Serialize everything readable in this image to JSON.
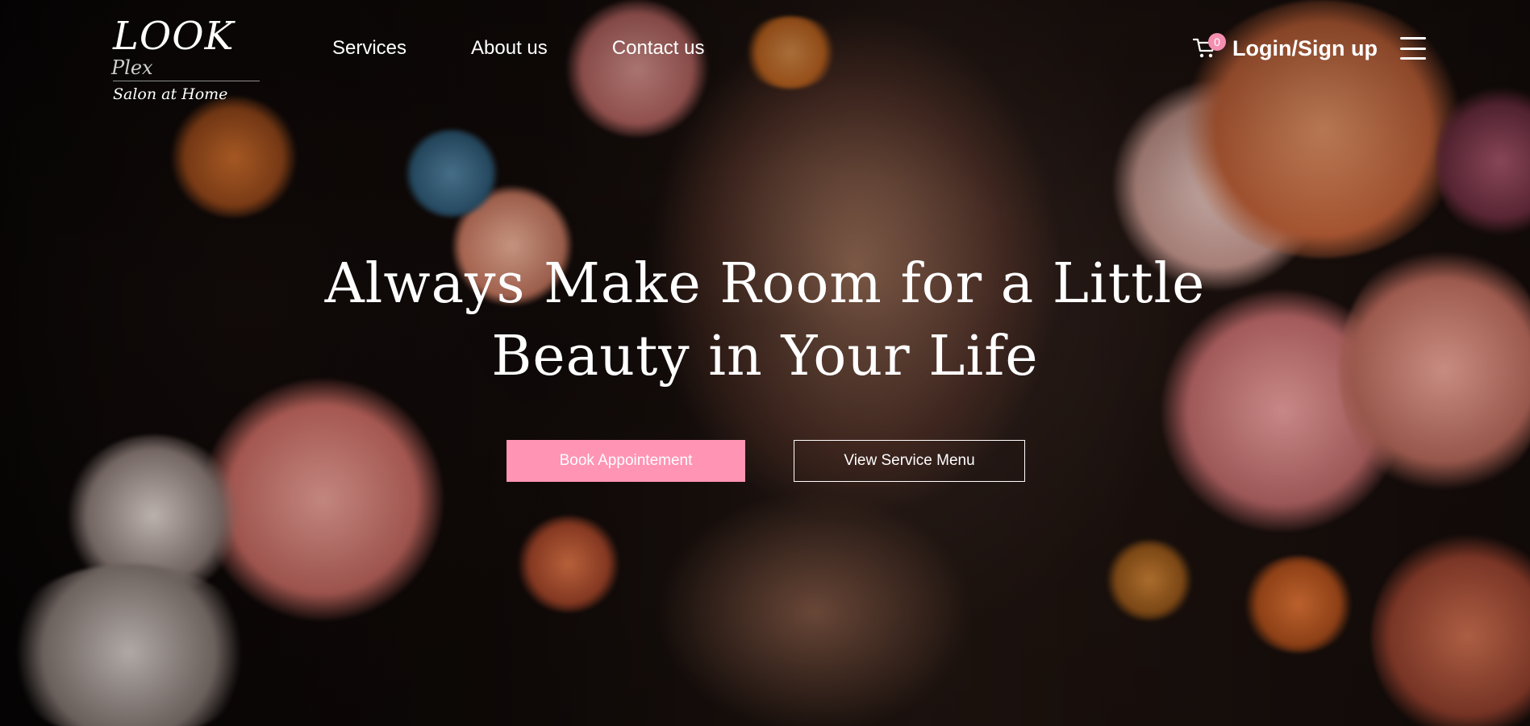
{
  "brand": {
    "logo_main": "LOOK",
    "logo_suffix": "Plex",
    "tagline": "Salon at Home"
  },
  "nav": {
    "items": [
      {
        "label": "Services"
      },
      {
        "label": "About us"
      },
      {
        "label": "Contact us"
      }
    ]
  },
  "header_actions": {
    "cart_icon": "cart-icon",
    "cart_count": "0",
    "login_label": "Login/Sign up",
    "menu_icon": "hamburger-menu-icon"
  },
  "hero": {
    "headline_line1": "Always Make Room for a Little",
    "headline_line2": "Beauty in Your Life",
    "primary_button": "Book Appointement",
    "secondary_button": "View Service Menu",
    "background_image": "woman with flowers in hair"
  },
  "colors": {
    "accent": "#ff94b4",
    "badge": "#f48fb1",
    "text": "#ffffff",
    "background": "#0b0706"
  }
}
